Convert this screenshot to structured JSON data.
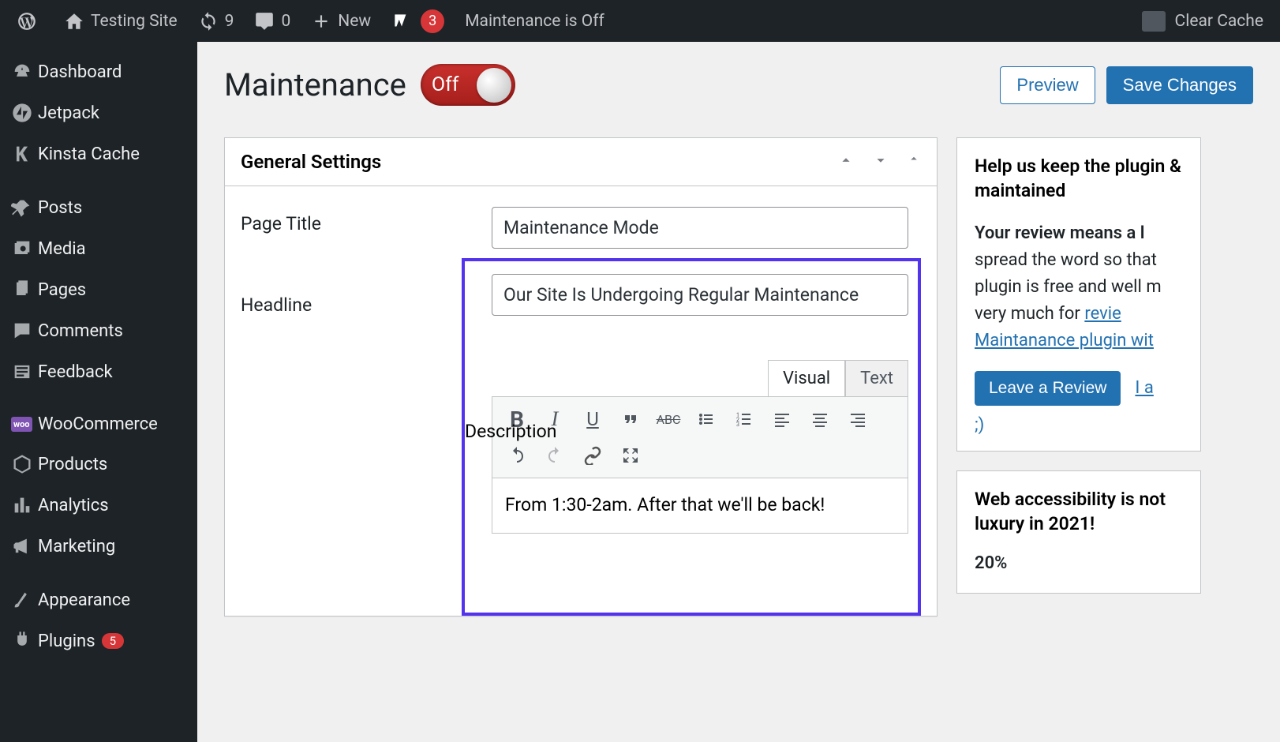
{
  "adminbar": {
    "site_name": "Testing Site",
    "updates_count": "9",
    "comments_count": "0",
    "new_label": "New",
    "yoast_count": "3",
    "maintenance_status": "Maintenance is Off",
    "clear_cache": "Clear Cache"
  },
  "sidebar": {
    "items": [
      {
        "label": "Dashboard"
      },
      {
        "label": "Jetpack"
      },
      {
        "label": "Kinsta Cache"
      },
      {
        "label": "Posts"
      },
      {
        "label": "Media"
      },
      {
        "label": "Pages"
      },
      {
        "label": "Comments"
      },
      {
        "label": "Feedback"
      },
      {
        "label": "WooCommerce"
      },
      {
        "label": "Products"
      },
      {
        "label": "Analytics"
      },
      {
        "label": "Marketing"
      },
      {
        "label": "Appearance"
      },
      {
        "label": "Plugins",
        "badge": "5"
      }
    ]
  },
  "page": {
    "title": "Maintenance",
    "toggle_state": "Off",
    "preview_label": "Preview",
    "save_label": "Save Changes"
  },
  "settings": {
    "panel_title": "General Settings",
    "page_title_label": "Page Title",
    "page_title_value": "Maintenance Mode",
    "headline_label": "Headline",
    "headline_value": "Our Site Is Undergoing Regular Maintenance",
    "description_label": "Description",
    "editor_tabs": {
      "visual": "Visual",
      "text": "Text"
    },
    "description_value": "From 1:30-2am. After that we'll be back!"
  },
  "sidepanel": {
    "help_title": "Help us keep the plugin & maintained",
    "review_text_bold": "Your review means a l",
    "review_text_rest": "spread the word so that plugin is free and well m very much for ",
    "review_link": "revie",
    "review_link2": "Maintanance plugin wit",
    "leave_review": "Leave a Review",
    "already": "I a",
    "wink": ";)",
    "accessibility_title": "Web accessibility is not luxury in 2021!",
    "accessibility_text": "20%"
  }
}
